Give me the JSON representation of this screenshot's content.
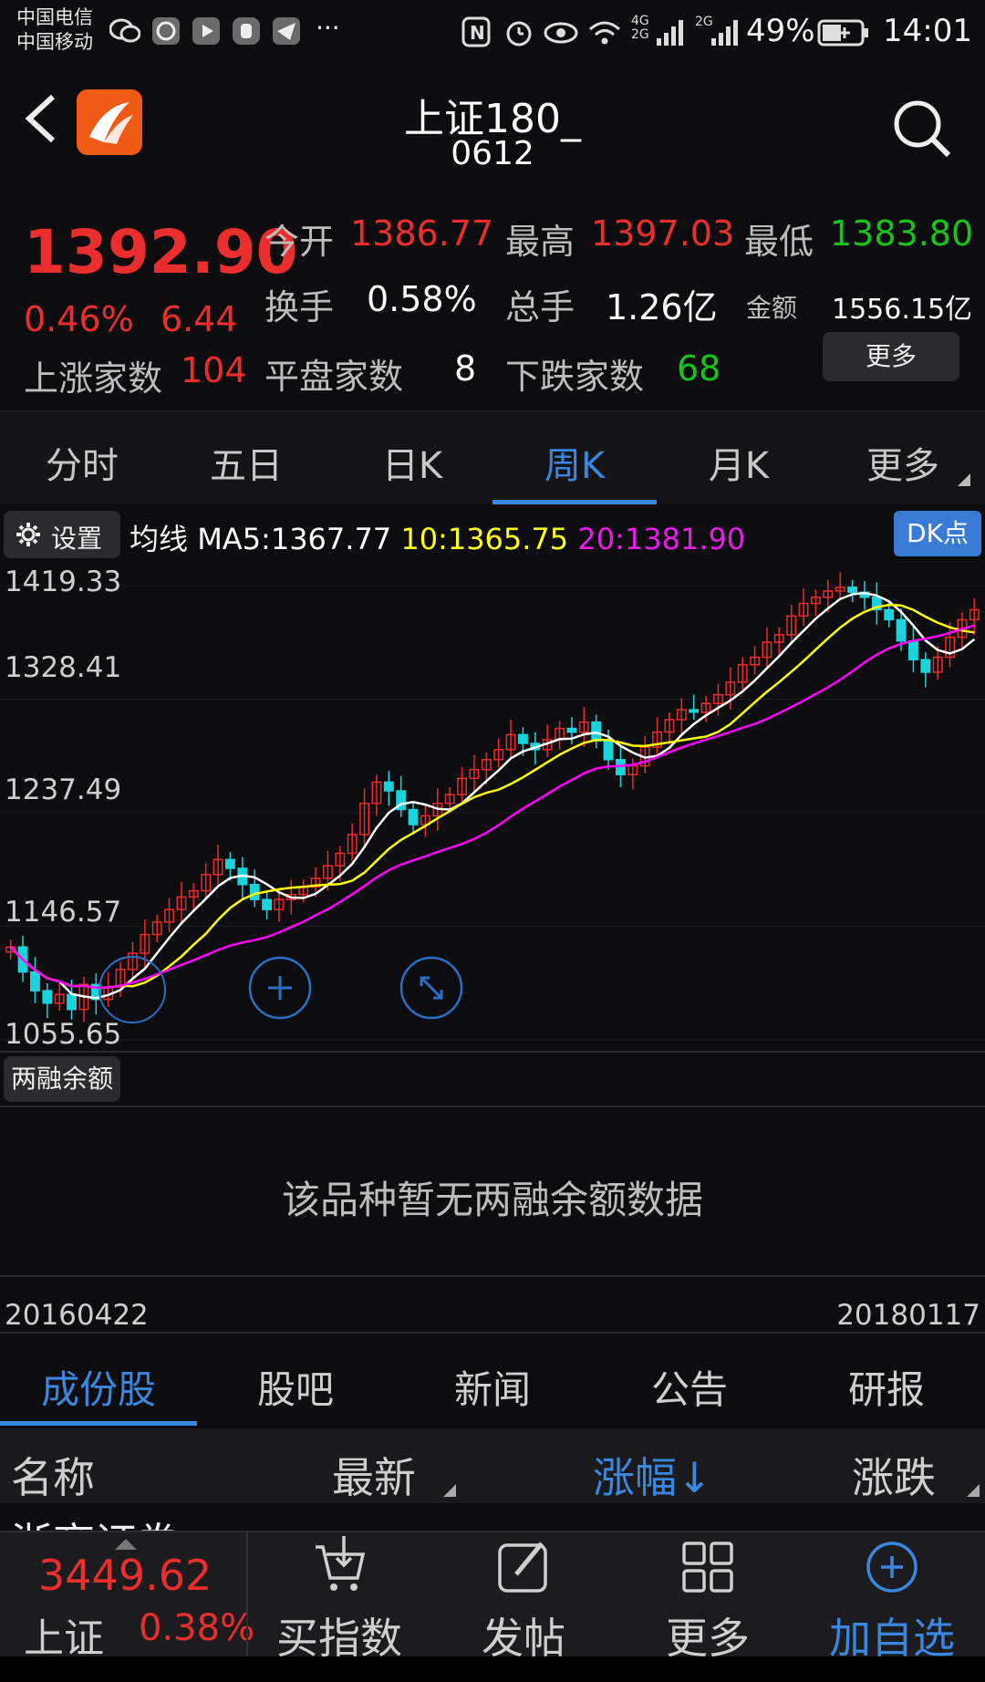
{
  "status_bar": {
    "carrier1": "中国电信",
    "carrier2": "中国移动",
    "net1": "4G",
    "net2": "2G",
    "net3": "2G",
    "battery": "49%",
    "time": "14:01",
    "more": "···"
  },
  "header": {
    "title": "上证180_",
    "code": "0612"
  },
  "quote": {
    "price": "1392.90",
    "change_pct": "0.46%",
    "change": "6.44",
    "up_label": "上涨家数",
    "up_count": "104",
    "open_label": "今开",
    "open": "1386.77",
    "high_label": "最高",
    "high": "1397.03",
    "low_label": "最低",
    "low": "1383.80",
    "turnover_label": "换手",
    "turnover": "0.58%",
    "volume_label": "总手",
    "volume": "1.26亿",
    "amount_label": "金额",
    "amount": "1556.15亿",
    "flat_label": "平盘家数",
    "flat_count": "8",
    "down_label": "下跌家数",
    "down_count": "68",
    "more_label": "更多"
  },
  "period_tabs": [
    "分时",
    "五日",
    "日K",
    "周K",
    "月K",
    "更多"
  ],
  "active_period": 3,
  "chart_header": {
    "settings_label": "设置",
    "ma_label": "均线",
    "ma5": "MA5:1367.77",
    "ma10": "10:1365.75",
    "ma20": "20:1381.90",
    "dk_label": "DK点"
  },
  "chart_data": {
    "type": "candlestick",
    "y_ticks": [
      "1419.33",
      "1328.41",
      "1237.49",
      "1146.57",
      "1055.65"
    ],
    "ylim": [
      1055.65,
      1419.33
    ],
    "x_start": "20160422",
    "x_end": "20180117",
    "series": [
      {
        "name": "MA5",
        "color": "#ffffff"
      },
      {
        "name": "MA10",
        "color": "#ffff00"
      },
      {
        "name": "MA20",
        "color": "#ff00ff"
      }
    ],
    "closes": [
      1130,
      1110,
      1095,
      1085,
      1092,
      1080,
      1100,
      1088,
      1098,
      1112,
      1125,
      1140,
      1150,
      1160,
      1170,
      1175,
      1188,
      1200,
      1193,
      1180,
      1168,
      1160,
      1168,
      1172,
      1178,
      1185,
      1195,
      1205,
      1220,
      1245,
      1262,
      1255,
      1240,
      1228,
      1235,
      1245,
      1252,
      1265,
      1272,
      1280,
      1288,
      1300,
      1293,
      1288,
      1296,
      1305,
      1302,
      1310,
      1295,
      1280,
      1268,
      1275,
      1290,
      1302,
      1312,
      1320,
      1318,
      1325,
      1332,
      1342,
      1356,
      1362,
      1374,
      1380,
      1395,
      1405,
      1410,
      1415,
      1418,
      1414,
      1410,
      1400,
      1392,
      1375,
      1360,
      1350,
      1362,
      1378,
      1392,
      1400
    ],
    "colors": {
      "up": "#ec2a2a",
      "down": "#19d3dd"
    }
  },
  "margin": {
    "chip_label": "两融余额",
    "empty_message": "该品种暂无两融余额数据"
  },
  "bottom_tabs": [
    "成份股",
    "股吧",
    "新闻",
    "公告",
    "研报"
  ],
  "active_bottom_tab": 0,
  "table": {
    "col_name": "名称",
    "col_latest": "最新",
    "col_change_pct": "涨幅↓",
    "col_change": "涨跌",
    "first_row_partial": "浙商证券"
  },
  "bottom_bar": {
    "index_value": "3449.62",
    "index_name": "上证",
    "index_change": "0.38%",
    "nav": [
      "买指数",
      "发帖",
      "更多",
      "加自选"
    ]
  }
}
